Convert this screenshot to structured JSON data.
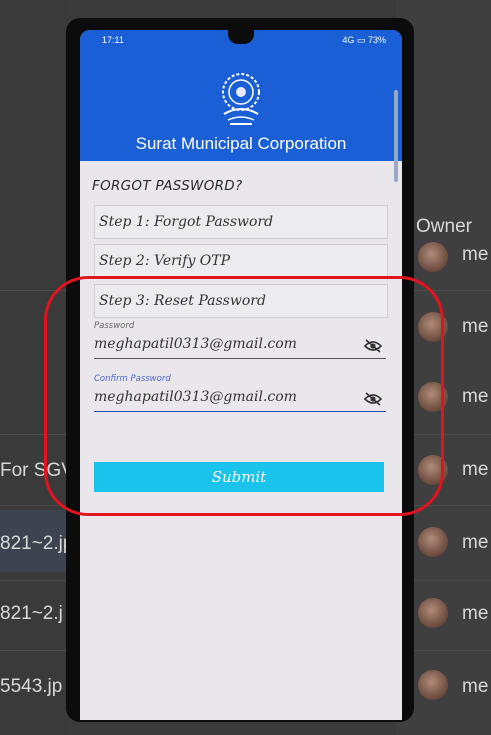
{
  "status_bar": {
    "time": "17:11",
    "right_text": "4G",
    "battery": "73%"
  },
  "header": {
    "emblem_icon": "surat-municipal-corporation-emblem",
    "title": "Surat Municipal Corporation"
  },
  "form": {
    "heading": "FORGOT PASSWORD?",
    "steps": [
      {
        "label": "Step 1: Forgot Password"
      },
      {
        "label": "Step 2: Verify OTP"
      },
      {
        "label": "Step 3: Reset Password"
      }
    ],
    "password": {
      "label": "Password",
      "value": "meghapatil0313@gmail.com"
    },
    "confirm_password": {
      "label": "Confirm Password",
      "value": "meghapatil0313@gmail.com"
    },
    "submit_label": "Submit"
  },
  "background": {
    "owner_label": "Owner",
    "row_snippets": [
      "For SGV",
      "821~2.jp",
      "821~2.j",
      "5543.jp"
    ],
    "row_suffix": [
      "me",
      "me",
      "me",
      "me",
      "me",
      "me",
      "me"
    ]
  },
  "colors": {
    "header_blue": "#1b5fd6",
    "submit_cyan": "#19c3ec",
    "annotation_red": "#e0141e"
  }
}
